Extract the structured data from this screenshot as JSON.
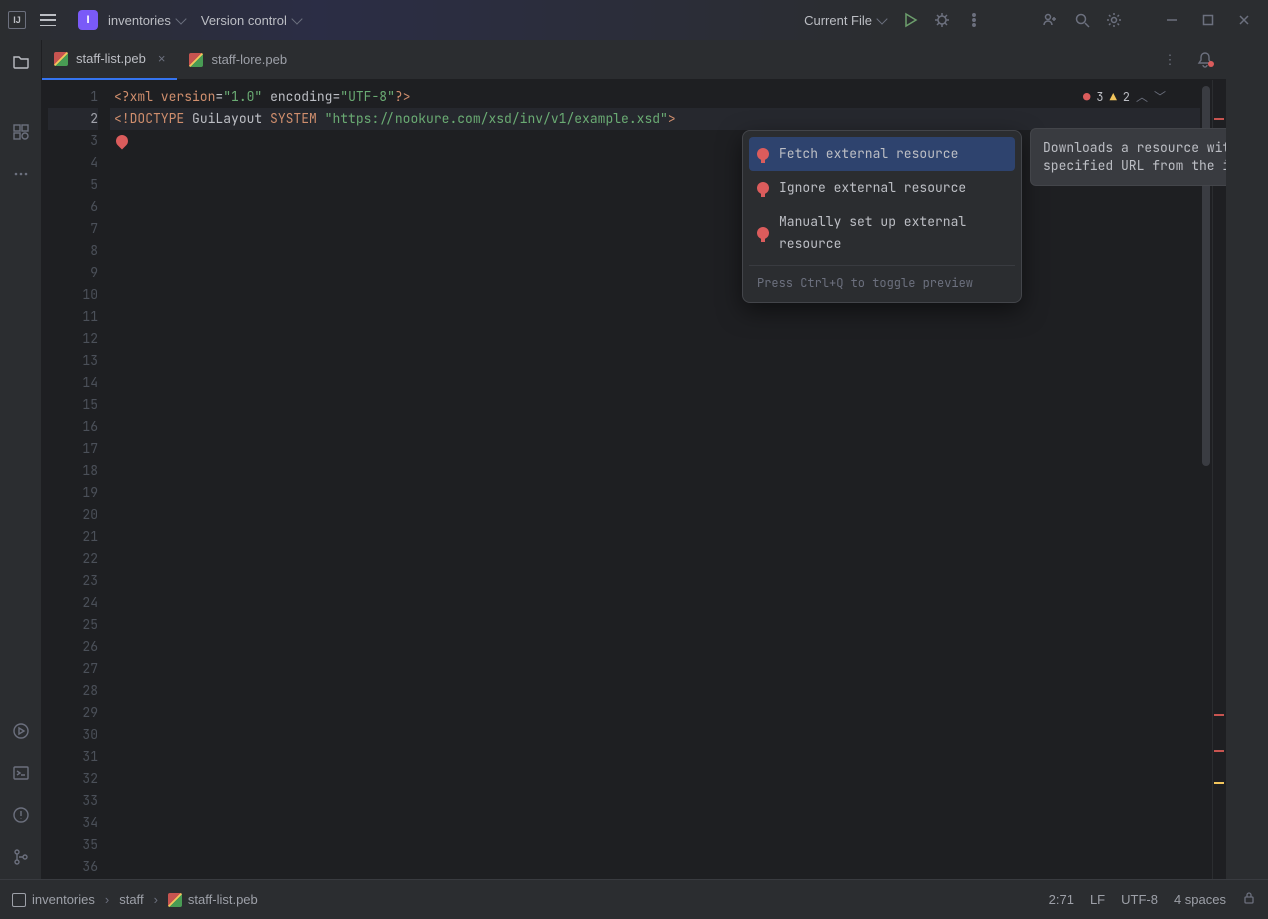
{
  "titlebar": {
    "project": "inventories",
    "project_badge": "I",
    "vcs": "Version control",
    "run_config": "Current File"
  },
  "tabs": [
    {
      "name": "staff-list.peb",
      "active": true
    },
    {
      "name": "staff-lore.peb",
      "active": false
    }
  ],
  "inspections": {
    "errors": "3",
    "warnings": "2"
  },
  "code": {
    "l1_a": "<?",
    "l1_b": "xml version",
    "l1_c": "=",
    "l1_d": "\"1.0\"",
    "l1_e": "encoding",
    "l1_f": "=",
    "l1_g": "\"UTF-8\"",
    "l1_h": "?>",
    "l2_a": "<!DOCTYPE ",
    "l2_b": "GuiLayout ",
    "l2_c": "SYSTEM ",
    "l2_d": "\"https://nookure.com/xsd/inv/v1/example.xsd\"",
    "l2_e": ">"
  },
  "popup": {
    "items": [
      "Fetch external resource",
      "Ignore external resource",
      "Manually set up external resource"
    ],
    "footer": "Press Ctrl+Q to toggle preview"
  },
  "tooltip": "Downloads a resource with the specified URL from the internet.",
  "breadcrumb": {
    "a": "inventories",
    "b": "staff",
    "c": "staff-list.peb"
  },
  "status": {
    "pos": "2:71",
    "eol": "LF",
    "enc": "UTF-8",
    "indent": "4 spaces"
  },
  "line_count": 36
}
